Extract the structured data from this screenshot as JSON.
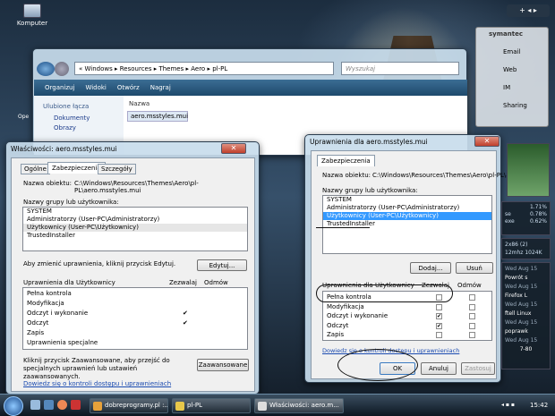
{
  "desktop": {
    "icon_label": "Komputer"
  },
  "explorer": {
    "path": [
      "«",
      "Windows",
      "Resources",
      "Themes",
      "Aero",
      "pl-PL"
    ],
    "search_placeholder": "Wyszukaj",
    "toolbar": [
      "Organizuj",
      "Widoki",
      "Otwórz",
      "Nagraj"
    ],
    "fav_title": "Ulubione łącza",
    "fav_items": [
      "Dokumenty",
      "Obrazy"
    ],
    "col_name": "Nazwa",
    "file": "aero.msstyles.mui",
    "frag_label": "Ope"
  },
  "props": {
    "title": "Właściwości: aero.msstyles.mui",
    "tabs": [
      "Ogólne",
      "Zabezpieczenia",
      "Szczegóły"
    ],
    "object_label": "Nazwa obiektu:",
    "object_path": "C:\\Windows\\Resources\\Themes\\Aero\\pl-PL\\aero.msstyles.mui",
    "group_label": "Nazwy grupy lub użytkownika:",
    "users": [
      "SYSTEM",
      "Administratorzy (User-PC\\Administratorzy)",
      "Użytkownicy (User-PC\\Użytkownicy)",
      "TrustedInstaller"
    ],
    "change_hint": "Aby zmienić uprawnienia, kliknij przycisk Edytuj.",
    "edit_btn": "Edytuj...",
    "perm_label": "Uprawnienia dla Użytkownicy",
    "allow": "Zezwalaj",
    "deny": "Odmów",
    "perms": [
      "Pełna kontrola",
      "Modyfikacja",
      "Odczyt i wykonanie",
      "Odczyt",
      "Zapis",
      "Uprawnienia specjalne"
    ],
    "perm_checks": [
      "",
      "",
      "✔",
      "✔",
      "",
      ""
    ],
    "adv_hint": "Kliknij przycisk Zaawansowane, aby przejść do specjalnych uprawnień lub ustawień zaawansowanych.",
    "adv_btn": "Zaawansowane",
    "link": "Dowiedz się o kontroli dostępu i uprawnieniach"
  },
  "perms_dialog": {
    "title": "Uprawnienia dla aero.msstyles.mui",
    "tab": "Zabezpieczenia",
    "object_label": "Nazwa obiektu:",
    "object_path": "C:\\Windows\\Resources\\Themes\\Aero\\pl-PL\\aero",
    "group_label": "Nazwy grupy lub użytkownika:",
    "users": [
      "SYSTEM",
      "Administratorzy (User-PC\\Administratorzy)",
      "Użytkownicy (User-PC\\Użytkownicy)",
      "TrustedInstaller"
    ],
    "add_btn": "Dodaj...",
    "remove_btn": "Usuń",
    "perm_label": "Uprawnienia dla Użytkownicy",
    "allow": "Zezwalaj",
    "deny": "Odmów",
    "perms": [
      "Pełna kontrola",
      "Modyfikacja",
      "Odczyt i wykonanie",
      "Odczyt",
      "Zapis"
    ],
    "allow_checks": [
      false,
      false,
      true,
      true,
      false
    ],
    "link": "Dowiedz się o kontroli dostępu i uprawnieniach",
    "ok": "OK",
    "cancel": "Anuluj",
    "apply": "Zastosuj"
  },
  "gadgets": {
    "brand": "symantec",
    "items": [
      "Email",
      "Web",
      "IM",
      "Sharing"
    ],
    "cpu": [
      "1.71%",
      "0.78%",
      "0.62%"
    ],
    "cpu_labels": [
      "",
      "se",
      "exe"
    ],
    "net": [
      "2x86 (2)",
      "12mhz 1024K"
    ],
    "feeds": [
      "Wed Aug 15",
      "Powrót s",
      "Wed Aug 15",
      "Firefox L",
      "Wed Aug 15",
      "ftell Linux",
      "Wed Aug 15",
      "poprawk",
      "Wed Aug 15"
    ],
    "footer": "7-80"
  },
  "taskbar": {
    "items": [
      "dobreprogramy.pl :...",
      "pl-PL",
      "Właściwości: aero.m..."
    ],
    "time": "15:42"
  }
}
